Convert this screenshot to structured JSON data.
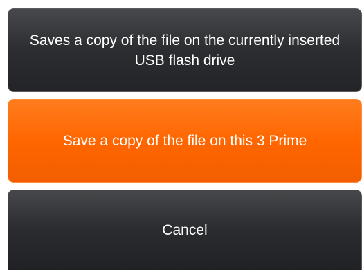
{
  "menu": {
    "options": [
      {
        "label": "Saves a copy of the file on the currently inserted USB flash drive"
      },
      {
        "label": "Save a copy of the file on this 3 Prime"
      },
      {
        "label": "Cancel"
      }
    ]
  },
  "colors": {
    "highlight": "#ff6600",
    "button_dark": "#2c2e31",
    "text": "#ffffff",
    "background": "#ffffff"
  }
}
